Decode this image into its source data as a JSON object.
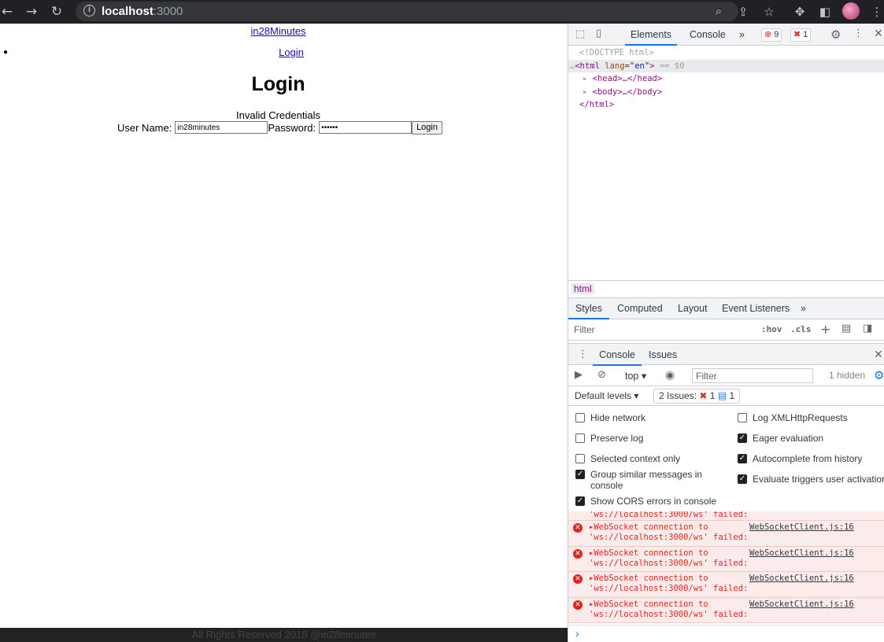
{
  "browser": {
    "url_host": "localhost",
    "url_port": ":3000",
    "back_icon": "arrow-left-icon",
    "forward_icon": "arrow-right-icon",
    "reload_icon": "reload-icon"
  },
  "page": {
    "brand_link": "in28Minutes",
    "login_link": "Login",
    "title": "Login",
    "error": "Invalid Credentials",
    "username_label": "User Name:",
    "username_value": "in28minutes",
    "password_label": "Password:",
    "password_value": "••••••",
    "login_button": "Login",
    "footer": "All Rights Reserved 2018 @in28minutes"
  },
  "devtools": {
    "tabs": {
      "elements": "Elements",
      "console": "Console",
      "more": "»"
    },
    "error_count": "9",
    "issue_count": "1",
    "tree": {
      "doctype": "<!DOCTYPE html>",
      "html_open_tag": "<html",
      "html_attr_name": "lang",
      "html_attr_value": "\"en\"",
      "html_suffix": "== $0",
      "head": "<head>…</head>",
      "body": "<body>…</body>",
      "html_close": "</html>"
    },
    "breadcrumb": "html",
    "styles_tabs": [
      "Styles",
      "Computed",
      "Layout",
      "Event Listeners",
      "»"
    ],
    "styles_filter_placeholder": "Filter",
    "hov": ":hov",
    "cls": ".cls",
    "drawer_tabs": {
      "console": "Console",
      "issues": "Issues"
    },
    "context": "top",
    "console_filter_placeholder": "Filter",
    "hidden": "1 hidden",
    "default_levels": "Default levels",
    "issues_label": "2 Issues:",
    "issues_red": "1",
    "issues_blue": "1",
    "settings_left": [
      {
        "label": "Hide network",
        "checked": false
      },
      {
        "label": "Preserve log",
        "checked": false
      },
      {
        "label": "Selected context only",
        "checked": false
      },
      {
        "label": "Group similar messages in console",
        "checked": true
      },
      {
        "label": "Show CORS errors in console",
        "checked": true
      }
    ],
    "settings_right": [
      {
        "label": "Log XMLHttpRequests",
        "checked": false
      },
      {
        "label": "Eager evaluation",
        "checked": true
      },
      {
        "label": "Autocomplete from history",
        "checked": true
      },
      {
        "label": "Evaluate triggers user activation",
        "checked": true
      }
    ],
    "messages": {
      "partial_line": "'ws://localhost:3000/ws' failed:",
      "line1": "WebSocket connection to",
      "line2": "'ws://localhost:3000/ws' failed:",
      "source": "WebSocketClient.js:16"
    },
    "prompt": "›"
  }
}
